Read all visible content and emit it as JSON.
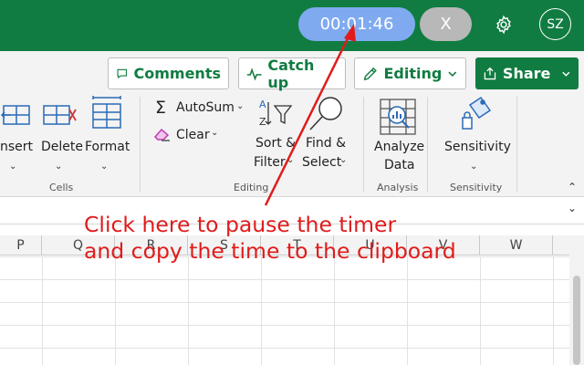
{
  "titlebar": {
    "timer_value": "00:01:46",
    "close_label": "X",
    "avatar_initials": "SZ",
    "settings_icon": "gear-icon",
    "colors": {
      "bar": "#107C41",
      "timer_pill": "#7FAAF0",
      "close_pill": "#B8B8B8"
    }
  },
  "commands": {
    "comments": {
      "label": "Comments",
      "icon": "comment-icon"
    },
    "catchup": {
      "label": "Catch up",
      "icon": "pulse-icon"
    },
    "editing": {
      "label": "Editing",
      "icon": "pencil-icon"
    },
    "share": {
      "label": "Share",
      "icon": "share-icon"
    }
  },
  "ribbon": {
    "cells": {
      "group_label": "Cells",
      "insert_label": "nsert",
      "delete_label": "Delete",
      "format_label": "Format"
    },
    "editing": {
      "group_label": "Editing",
      "autosum_label": "AutoSum",
      "clear_label": "Clear",
      "sortfilter_line1": "Sort &",
      "sortfilter_line2": "Filter",
      "findselect_line1": "Find &",
      "findselect_line2": "Select"
    },
    "analysis": {
      "group_label": "Analysis",
      "analyze_line1": "Analyze",
      "analyze_line2": "Data"
    },
    "sensitivity": {
      "group_label": "Sensitivity",
      "sensitivity_label": "Sensitivity"
    }
  },
  "grid": {
    "columns": [
      "P",
      "Q",
      "R",
      "S",
      "T",
      "U",
      "V",
      "W"
    ]
  },
  "annotation": {
    "line1": "Click here to pause the timer",
    "line2": "and copy the time to the clipboard",
    "color": "#E01B1B"
  }
}
